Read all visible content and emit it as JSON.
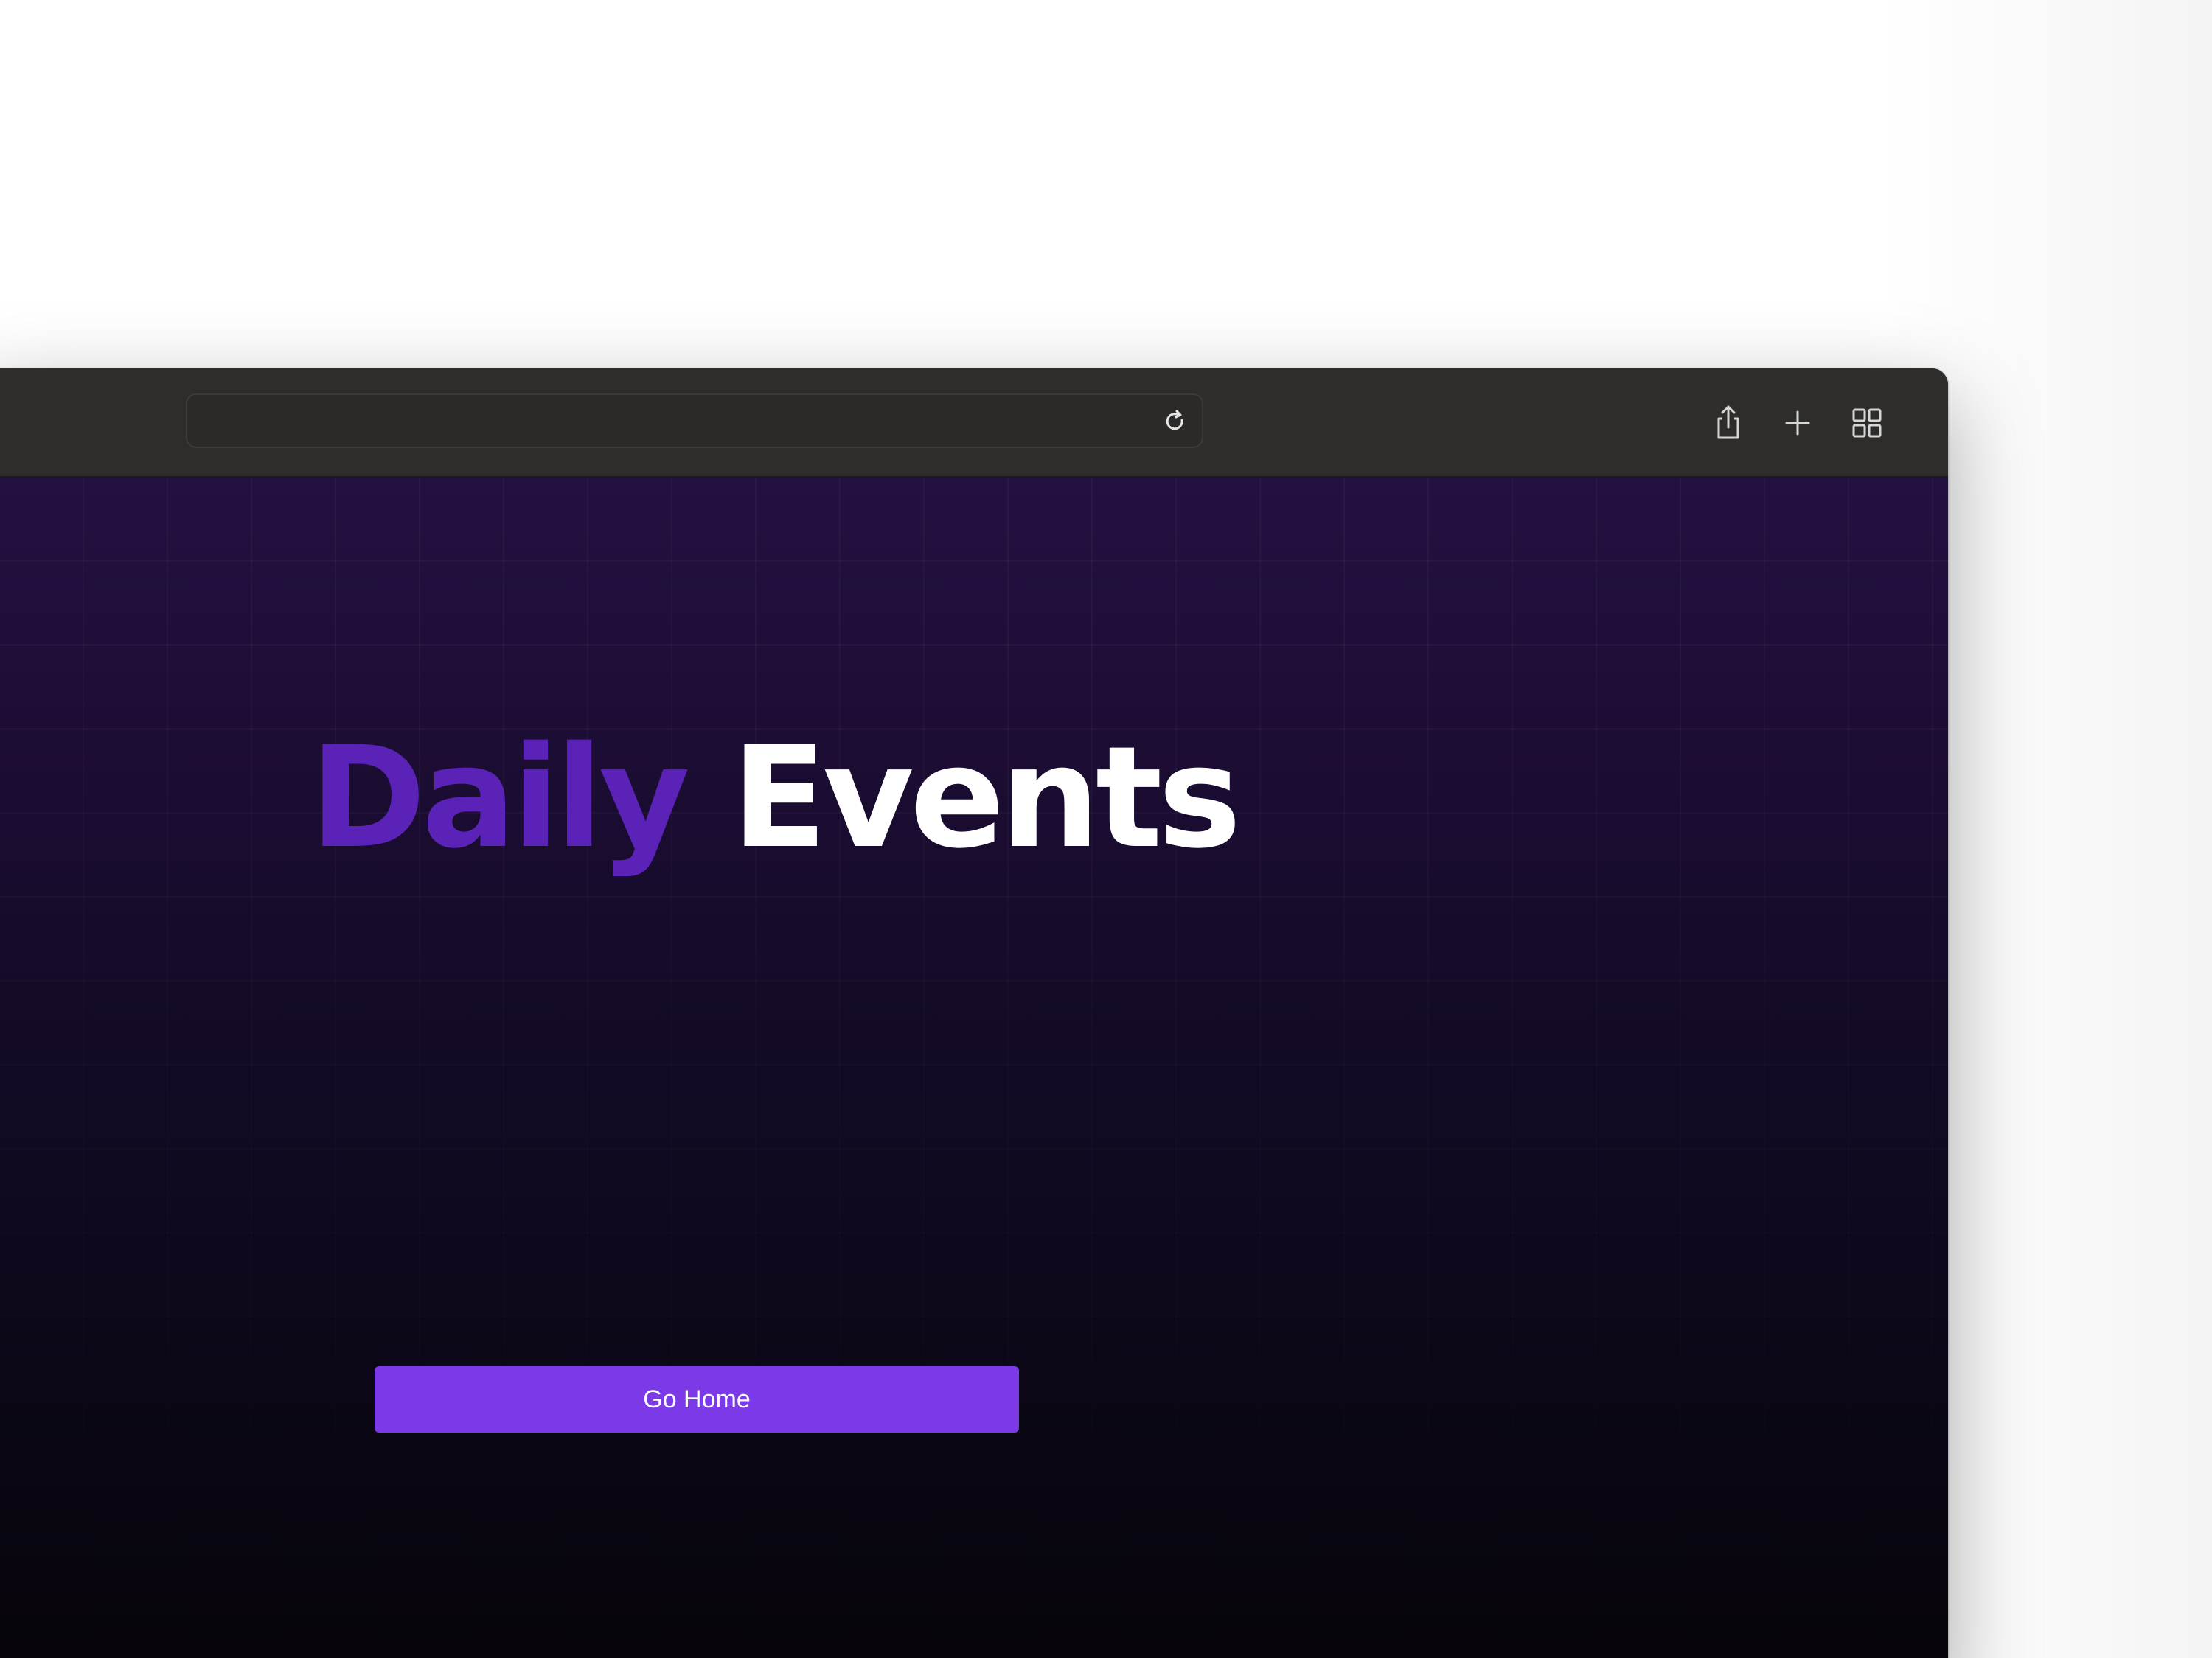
{
  "browser": {
    "address_bar_value": "",
    "toolbar_icons": [
      "reload-icon",
      "share-icon",
      "plus-icon",
      "tab-grid-icon"
    ]
  },
  "page": {
    "title_word_1": "Daily",
    "title_word_2": "Events",
    "go_home_label": "Go Home"
  },
  "colors": {
    "toolbar": "#2f2d2c",
    "title_accent": "#5b22b7",
    "title_main": "#ffffff",
    "button": "#7c39e8",
    "background_top": "#231141",
    "background_bottom": "#060409"
  }
}
